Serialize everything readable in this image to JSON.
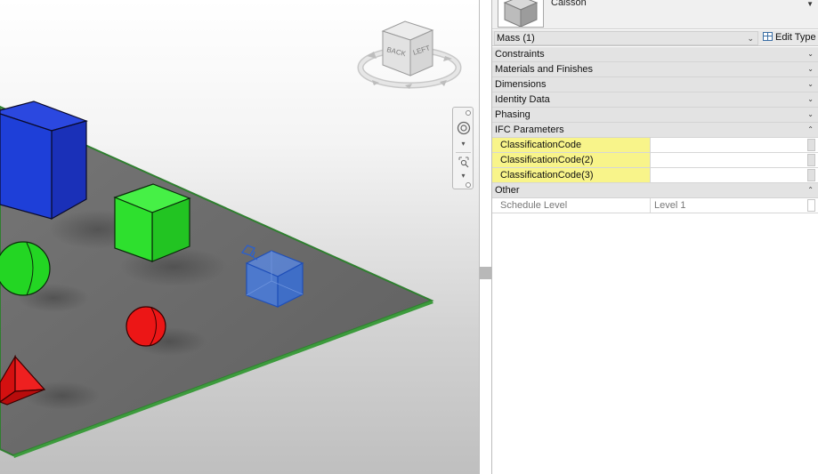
{
  "viewcube": {
    "back_label": "BACK",
    "left_label": "LEFT"
  },
  "properties": {
    "type_name": "Caisson",
    "instance_selector": "Mass (1)",
    "edit_type_label": "Edit Type",
    "groups": [
      {
        "label": "Constraints",
        "chevron": "⌄"
      },
      {
        "label": "Materials and Finishes",
        "chevron": "⌄"
      },
      {
        "label": "Dimensions",
        "chevron": "⌄"
      },
      {
        "label": "Identity Data",
        "chevron": "⌄"
      },
      {
        "label": "Phasing",
        "chevron": "⌄"
      },
      {
        "label": "IFC Parameters",
        "chevron": "⌃"
      },
      {
        "label": "Other",
        "chevron": "⌃"
      }
    ],
    "ifc_parameters": [
      {
        "name": "ClassificationCode",
        "value": ""
      },
      {
        "name": "ClassificationCode(2)",
        "value": ""
      },
      {
        "name": "ClassificationCode(3)",
        "value": ""
      }
    ],
    "other_parameters": [
      {
        "name": "Schedule Level",
        "value": "Level 1"
      }
    ]
  },
  "colors": {
    "highlight": "#f8f48a",
    "floor": "#6b6b6b",
    "floor_edge": "#3a9a3a",
    "blue_box": "#1f3fd6",
    "green_box": "#2ee02e",
    "red_shape": "#e81414",
    "selected_box": "#3b6fd1"
  }
}
